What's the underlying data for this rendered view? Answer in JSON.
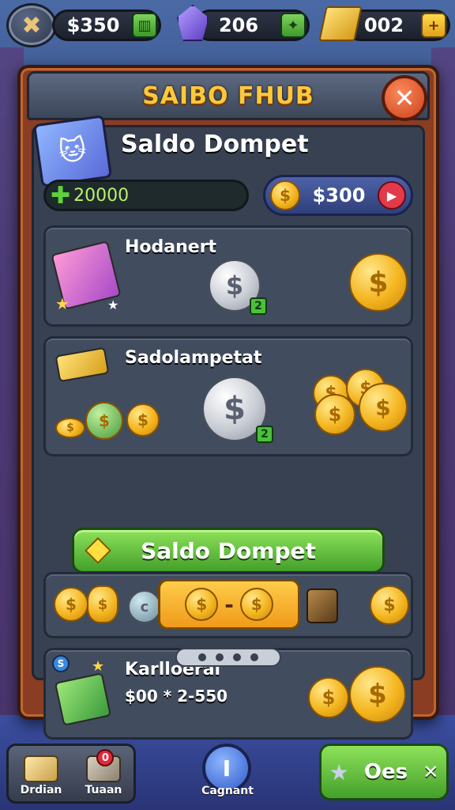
{
  "topbar": {
    "cash_value": "$350",
    "gems_value": "206",
    "gold_value": "002"
  },
  "panel": {
    "title": "SAIBO FHUB",
    "section_title": "Saldo Dompet",
    "balance_amount": "20000",
    "wallet_amount": "$300"
  },
  "cards": [
    {
      "label": "Hodanert"
    },
    {
      "label": "Sadolampetat"
    },
    {
      "label": "Karlloeral",
      "sub": "$00 * 2-550"
    }
  ],
  "cta": {
    "label": "Saldo Dompet"
  },
  "bottom_nav": {
    "left_items": [
      {
        "label": "Drdian"
      },
      {
        "label": "Tuaan",
        "badge": "0"
      }
    ],
    "center_label": "Cagnant",
    "center_glyph": "I",
    "right_button": "Oes"
  },
  "colors": {
    "accent_green": "#44a02a",
    "panel_brown": "#8a3d22",
    "title_gold": "#ffc83a"
  }
}
